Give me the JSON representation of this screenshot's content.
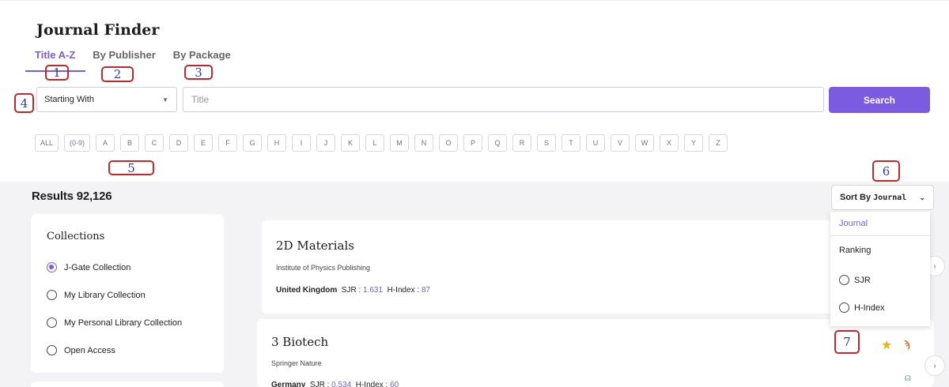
{
  "app": {
    "title": "Journal Finder"
  },
  "tabs": [
    {
      "label": "Title A-Z",
      "active": true
    },
    {
      "label": "By Publisher",
      "active": false
    },
    {
      "label": "By Package",
      "active": false
    }
  ],
  "search": {
    "mode_selected": "Starting With",
    "placeholder": "Title",
    "button_label": "Search"
  },
  "letters": [
    "ALL",
    "(0-9)",
    "A",
    "B",
    "C",
    "D",
    "E",
    "F",
    "G",
    "H",
    "I",
    "J",
    "K",
    "L",
    "M",
    "N",
    "O",
    "P",
    "Q",
    "R",
    "S",
    "T",
    "U",
    "V",
    "W",
    "X",
    "Y",
    "Z"
  ],
  "results": {
    "label": "Results 92,126"
  },
  "sort": {
    "label": "Sort By",
    "value": "Journal",
    "menu": {
      "journal": "Journal",
      "ranking": "Ranking",
      "sjr": "SJR",
      "hindex": "H-Index"
    }
  },
  "collections": {
    "heading": "Collections",
    "items": [
      {
        "label": "J-Gate Collection",
        "selected": true
      },
      {
        "label": "My Library Collection",
        "selected": false
      },
      {
        "label": "My Personal Library Collection",
        "selected": false
      },
      {
        "label": "Open Access",
        "selected": false
      }
    ]
  },
  "journals": [
    {
      "title": "2D Materials",
      "publisher": "Institute of Physics Publishing",
      "country": "United Kingdom",
      "sjr_label": "SJR :",
      "sjr": "1.631",
      "hindex_label": "H-Index :",
      "hindex": "87"
    },
    {
      "title": "3 Biotech",
      "publisher": "Springer Nature",
      "country": "Germany",
      "sjr_label": "SJR :",
      "sjr": "0.534",
      "hindex_label": "H-Index :",
      "hindex": "60"
    }
  ],
  "callouts": [
    "1",
    "2",
    "3",
    "4",
    "5",
    "6",
    "7"
  ],
  "colors": {
    "accent": "#7b5be0",
    "callout_border": "#c0282c",
    "callout_text": "#2a3fa8",
    "star": "#f0b400",
    "rss": "#e07a2a"
  },
  "icons": {
    "dropdown": "chevron-down-icon",
    "star": "star-icon",
    "rss": "rss-icon",
    "lock": "open-access-lock-icon",
    "next": "chevron-right-icon"
  }
}
